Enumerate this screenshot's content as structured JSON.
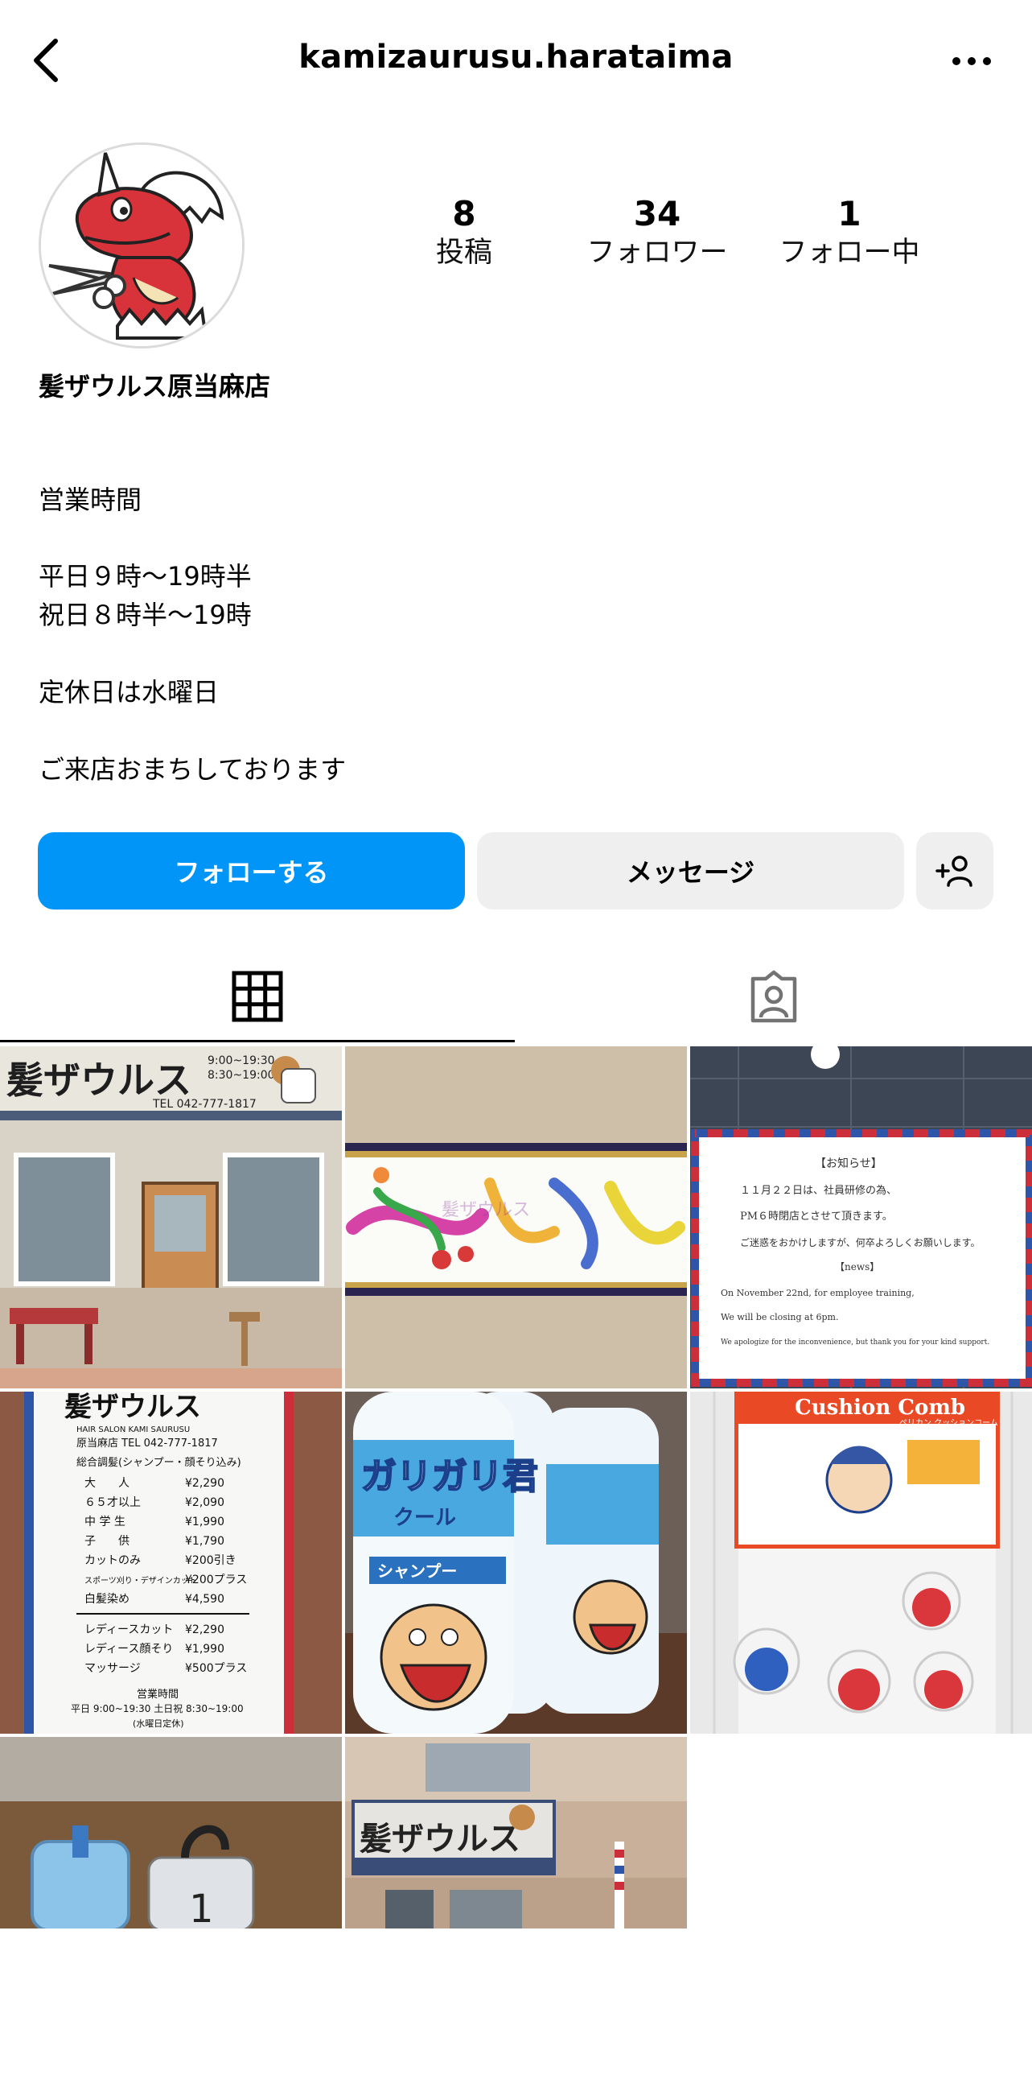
{
  "header": {
    "username": "kamizaurusu.harataima"
  },
  "profile": {
    "display_name": "髪ザウルス原当麻店",
    "stats": {
      "posts_value": "8",
      "posts_label": "投稿",
      "followers_value": "34",
      "followers_label": "フォロワー",
      "following_value": "1",
      "following_label": "フォロー中"
    },
    "bio": {
      "line1": "営業時間",
      "line2": "平日９時〜19時半",
      "line3": "祝日８時半〜19時",
      "line4": "定休日は水曜日",
      "line5": "ご来店おまちしております"
    }
  },
  "actions": {
    "follow_label": "フォローする",
    "message_label": "メッセージ"
  },
  "posts": {
    "shop_sign_text": "髪ザウルス",
    "shop_sign_phone": "TEL 042-777-1817",
    "shop_hours_1": "9:00~19:30",
    "shop_hours_2": "8:30~19:00",
    "calligraphy_text": "髪ザウルス",
    "notice_title": "【お知らせ】",
    "notice_jp_1": "１１月２２日は、社員研修の為、",
    "notice_jp_2": "PM６時閉店とさせて頂きます。",
    "notice_jp_3": "ご迷惑をおかけしますが、何卒よろしくお願いします。",
    "notice_news": "【news】",
    "notice_en_1": "On November 22nd, for employee training,",
    "notice_en_2": "We will be closing at 6pm.",
    "notice_en_3": "We apologize for the inconvenience, but thank you for your kind support.",
    "price_title": "髪ザウルス",
    "price_subtitle": "HAIR SALON KAMI SAURUSU",
    "price_phone": "原当麻店 TEL 042-777-1817",
    "price_heading": "総合調髪(シャンプー・顔そり込み)",
    "price_rows": [
      {
        "name": "大　　人",
        "price": "¥2,290"
      },
      {
        "name": "６５才以上",
        "price": "¥2,090"
      },
      {
        "name": "中 学 生",
        "price": "¥1,990"
      },
      {
        "name": "子　　供",
        "price": "¥1,790"
      },
      {
        "name": "カットのみ",
        "price": "¥200引き"
      },
      {
        "name": "スポーツ刈り・デザインカット",
        "price": "¥200プラス"
      },
      {
        "name": "白髪染め",
        "price": "¥4,590"
      },
      {
        "name": "レディースカット",
        "price": "¥2,290"
      },
      {
        "name": "レディース顔そり",
        "price": "¥1,990"
      },
      {
        "name": "マッサージ",
        "price": "¥500プラス"
      }
    ],
    "price_hours_title": "営業時間",
    "price_hours": "平日 9:00~19:30 土日祝 8:30~19:00",
    "price_closed": "(水曜日定休)",
    "shampoo_text": "ガリガリ君",
    "shampoo_sub": "クール",
    "shampoo_label": "シャンプー",
    "comb_title": "Cushion Comb",
    "comb_sub": "ペリカン クッションコーム",
    "ticket_number": "1",
    "shop2_sign": "髪ザウルス"
  },
  "colors": {
    "accent": "#0095f6",
    "secondary_button": "#efefef",
    "border": "#dbdbdb"
  },
  "icons": {
    "back": "chevron-left-icon",
    "more": "more-horizontal-icon",
    "suggest": "person-add-icon",
    "grid": "grid-icon",
    "tagged": "tagged-person-icon"
  }
}
